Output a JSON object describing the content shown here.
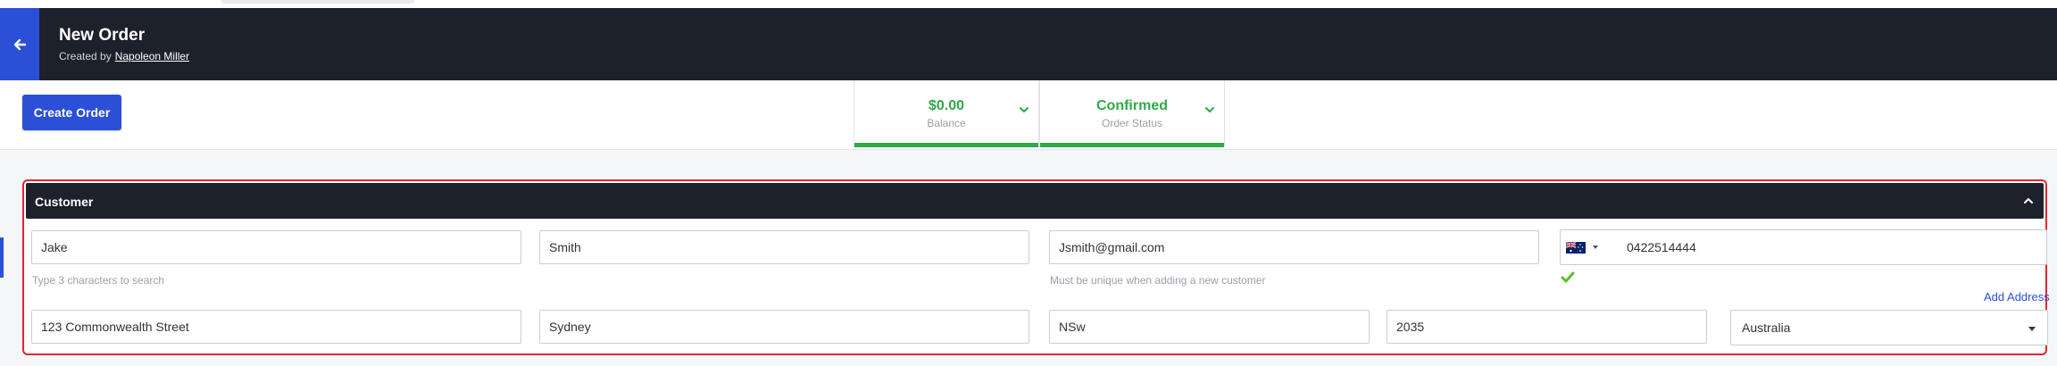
{
  "header": {
    "title": "New Order",
    "created_by_label": "Created by",
    "creator_name": "Napoleon Miller"
  },
  "toolbar": {
    "create_order_label": "Create Order",
    "balance": {
      "value": "$0.00",
      "label": "Balance"
    },
    "status": {
      "value": "Confirmed",
      "label": "Order Status"
    }
  },
  "customer": {
    "section_title": "Customer",
    "first_name": "Jake",
    "first_name_hint": "Type 3 characters to search",
    "last_name": "Smith",
    "email": "Jsmith@gmail.com",
    "email_hint": "Must be unique when adding a new customer",
    "phone_country": "Australia",
    "phone": "0422514444",
    "add_address_label": "Add Address",
    "street": "123 Commonwealth Street",
    "city": "Sydney",
    "state": "NSw",
    "postcode": "2035",
    "country": "Australia"
  },
  "colors": {
    "header_bg": "#1d212b",
    "accent_blue": "#2b4fd6",
    "status_green": "#2eaa4a",
    "highlight_red": "#e0262f"
  },
  "icons": [
    "arrow-left-icon",
    "chevron-down-icon",
    "chevron-up-icon",
    "australia-flag-icon",
    "caret-down-icon",
    "check-icon"
  ]
}
